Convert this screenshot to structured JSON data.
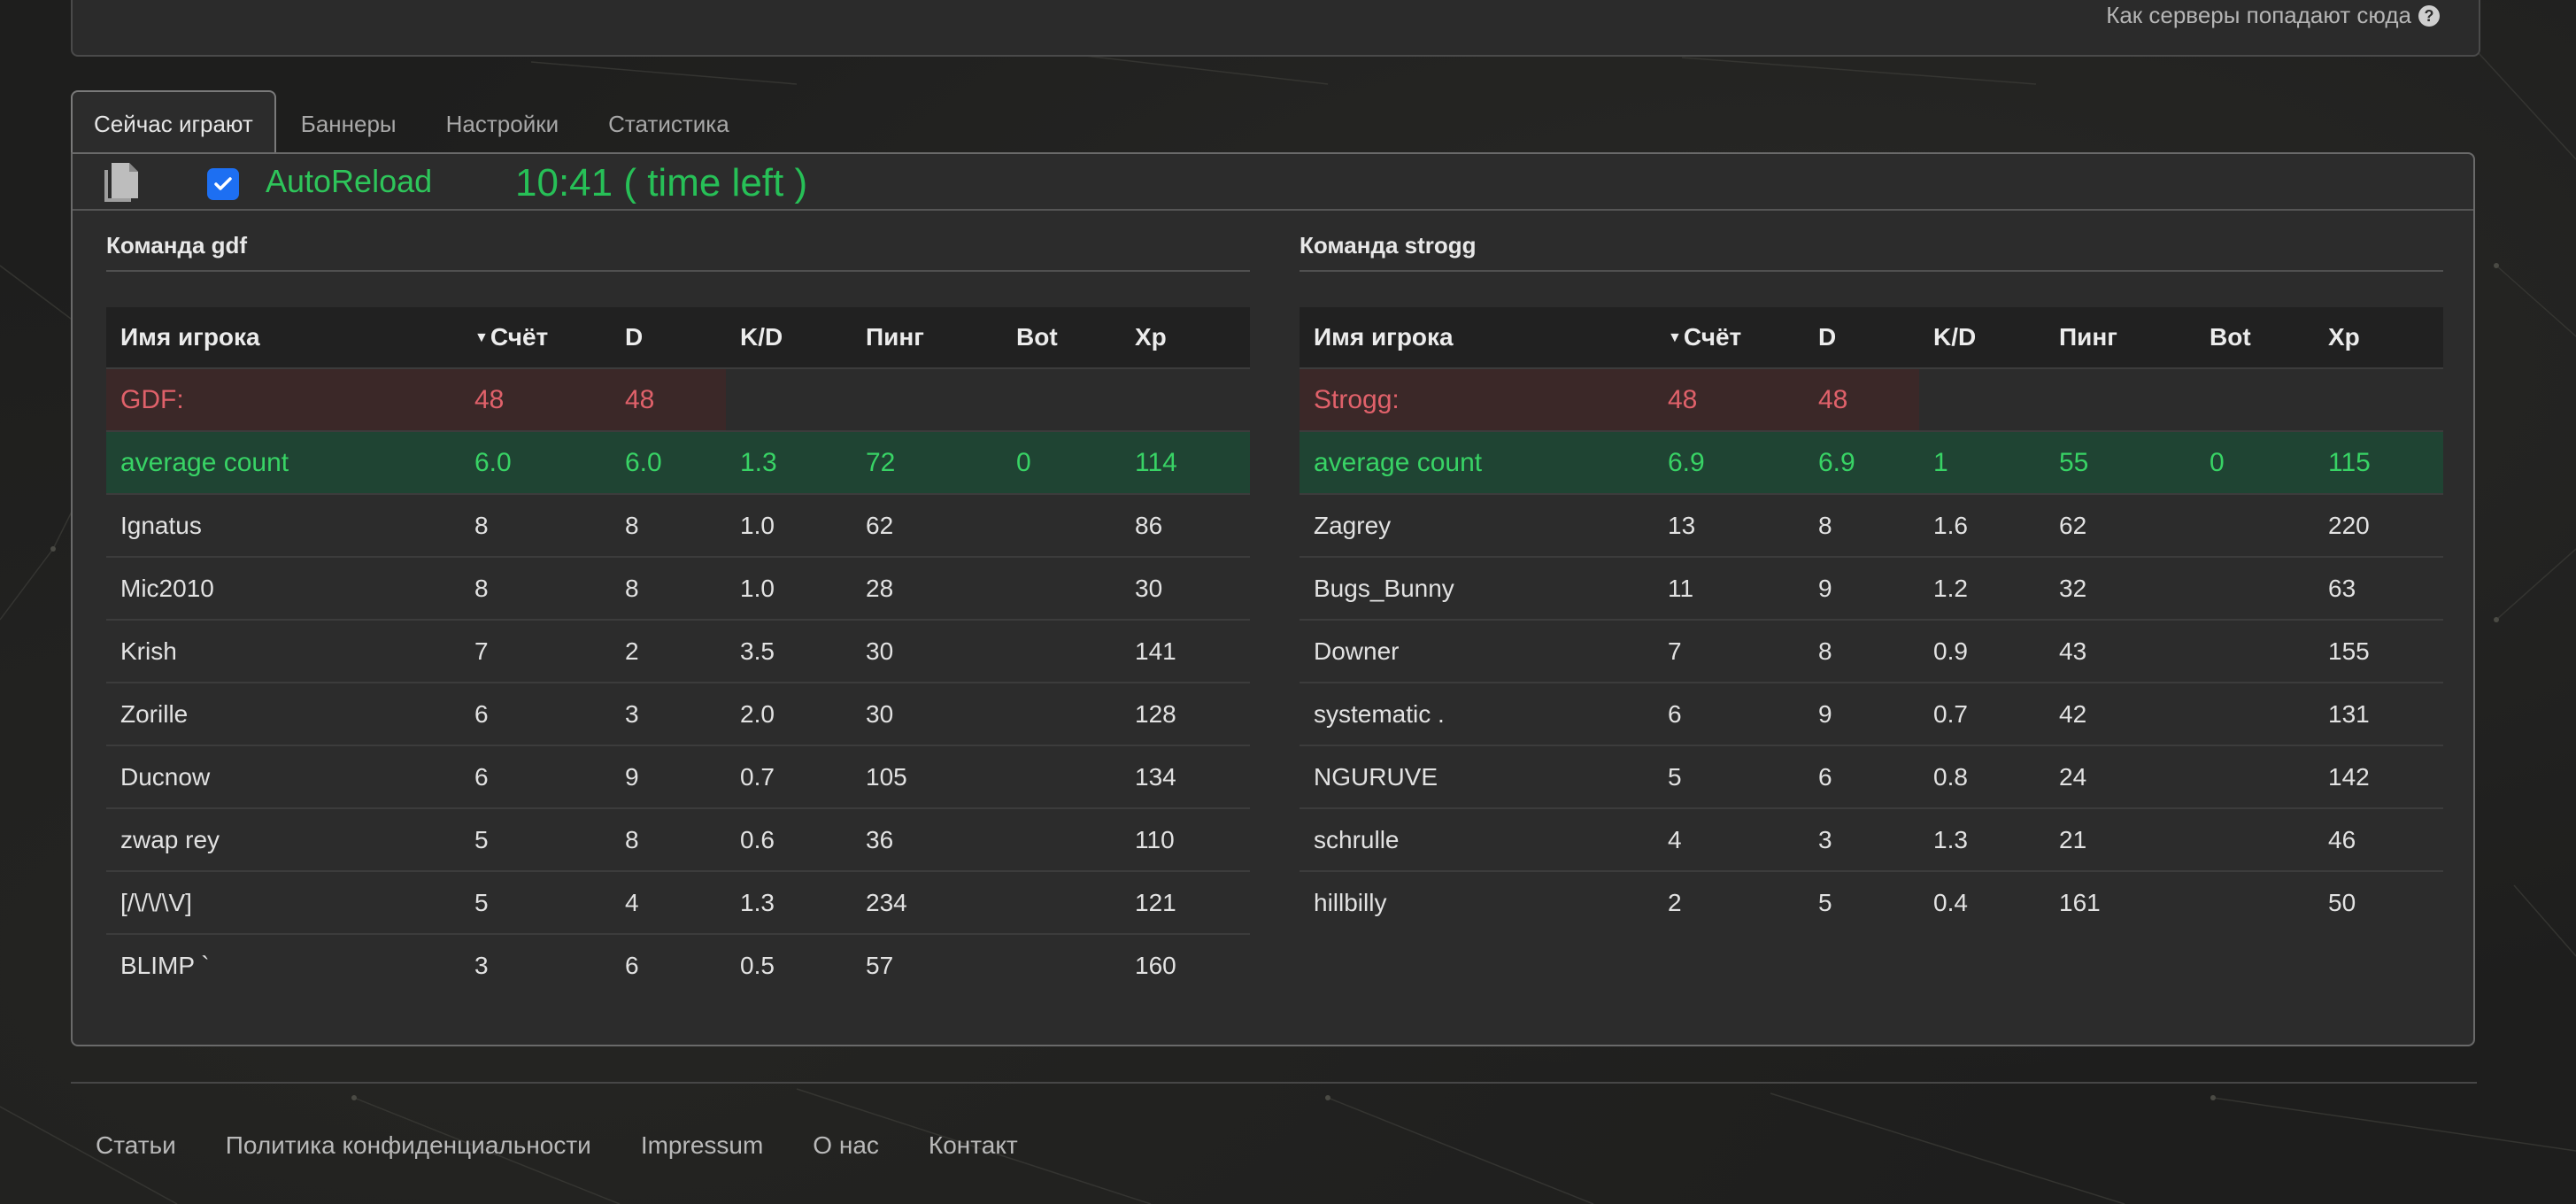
{
  "header": {
    "link_text": "Как серверы попадают сюда",
    "help_icon": "question-circle-icon"
  },
  "tabs": [
    {
      "label": "Сейчас играют",
      "active": true
    },
    {
      "label": "Баннеры",
      "active": false
    },
    {
      "label": "Настройки",
      "active": false
    },
    {
      "label": "Статистика",
      "active": false
    }
  ],
  "toolbar": {
    "copy_icon": "copy-icon",
    "autoreload_checked": true,
    "autoreload_label": "AutoReload",
    "timer_text": "10:41 ( time left )"
  },
  "colors": {
    "accent_green": "#27c057",
    "team_red": "#e0616a",
    "player_name": "#e8be8a",
    "kd_good": "#42d45e",
    "kd_neutral": "#f2e83a",
    "kd_bad": "#ef5a68",
    "kd_best": "#30e0c2",
    "checkbox_blue": "#1d6ff2"
  },
  "columns": [
    "Имя игрока",
    "Счёт",
    "D",
    "K/D",
    "Пинг",
    "Bot",
    "Xp"
  ],
  "teams": [
    {
      "title": "Команда gdf",
      "summary": {
        "label": "GDF:",
        "score": "48",
        "deaths": "48"
      },
      "average": {
        "label": "average count",
        "score": "6.0",
        "deaths": "6.0",
        "kd": "1.3",
        "ping": "72",
        "bot": "0",
        "xp": "114"
      },
      "players": [
        {
          "name": "Ignatus",
          "score": "8",
          "deaths": "8",
          "kd": "1.0",
          "kd_class": "kd-yellow",
          "ping": "62",
          "bot": "",
          "xp": "86"
        },
        {
          "name": "Mic2010",
          "score": "8",
          "deaths": "8",
          "kd": "1.0",
          "kd_class": "kd-yellow",
          "ping": "28",
          "bot": "",
          "xp": "30"
        },
        {
          "name": "Krish",
          "score": "7",
          "deaths": "2",
          "kd": "3.5",
          "kd_class": "kd-teal",
          "ping": "30",
          "bot": "",
          "xp": "141"
        },
        {
          "name": "Zorille",
          "score": "6",
          "deaths": "3",
          "kd": "2.0",
          "kd_class": "kd-green",
          "ping": "30",
          "bot": "",
          "xp": "128"
        },
        {
          "name": "Ducnow",
          "score": "6",
          "deaths": "9",
          "kd": "0.7",
          "kd_class": "kd-red",
          "ping": "105",
          "bot": "",
          "xp": "134"
        },
        {
          "name": "zwap rey",
          "score": "5",
          "deaths": "8",
          "kd": "0.6",
          "kd_class": "kd-red",
          "ping": "36",
          "bot": "",
          "xp": "110"
        },
        {
          "name": "[/\\/\\/\\V]",
          "score": "5",
          "deaths": "4",
          "kd": "1.3",
          "kd_class": "kd-green",
          "ping": "234",
          "bot": "",
          "xp": "121"
        },
        {
          "name": "BLIMP `",
          "score": "3",
          "deaths": "6",
          "kd": "0.5",
          "kd_class": "kd-red",
          "ping": "57",
          "bot": "",
          "xp": "160"
        }
      ]
    },
    {
      "title": "Команда strogg",
      "summary": {
        "label": "Strogg:",
        "score": "48",
        "deaths": "48"
      },
      "average": {
        "label": "average count",
        "score": "6.9",
        "deaths": "6.9",
        "kd": "1",
        "ping": "55",
        "bot": "0",
        "xp": "115"
      },
      "players": [
        {
          "name": "Zagrey",
          "score": "13",
          "deaths": "8",
          "kd": "1.6",
          "kd_class": "kd-green",
          "ping": "62",
          "bot": "",
          "xp": "220"
        },
        {
          "name": "Bugs_Bunny",
          "score": "11",
          "deaths": "9",
          "kd": "1.2",
          "kd_class": "kd-green",
          "ping": "32",
          "bot": "",
          "xp": "63"
        },
        {
          "name": "Downer",
          "score": "7",
          "deaths": "8",
          "kd": "0.9",
          "kd_class": "kd-yellow",
          "ping": "43",
          "bot": "",
          "xp": "155"
        },
        {
          "name": "systematic .",
          "score": "6",
          "deaths": "9",
          "kd": "0.7",
          "kd_class": "kd-red",
          "ping": "42",
          "bot": "",
          "xp": "131"
        },
        {
          "name": "NGURUVE",
          "score": "5",
          "deaths": "6",
          "kd": "0.8",
          "kd_class": "kd-yellow",
          "ping": "24",
          "bot": "",
          "xp": "142"
        },
        {
          "name": "schrulle",
          "score": "4",
          "deaths": "3",
          "kd": "1.3",
          "kd_class": "kd-green",
          "ping": "21",
          "bot": "",
          "xp": "46"
        },
        {
          "name": "hillbilly",
          "score": "2",
          "deaths": "5",
          "kd": "0.4",
          "kd_class": "kd-red",
          "ping": "161",
          "bot": "",
          "xp": "50"
        }
      ]
    }
  ],
  "footer": {
    "links": [
      "Статьи",
      "Политика конфиденциальности",
      "Impressum",
      "О нас",
      "Контакт"
    ]
  }
}
